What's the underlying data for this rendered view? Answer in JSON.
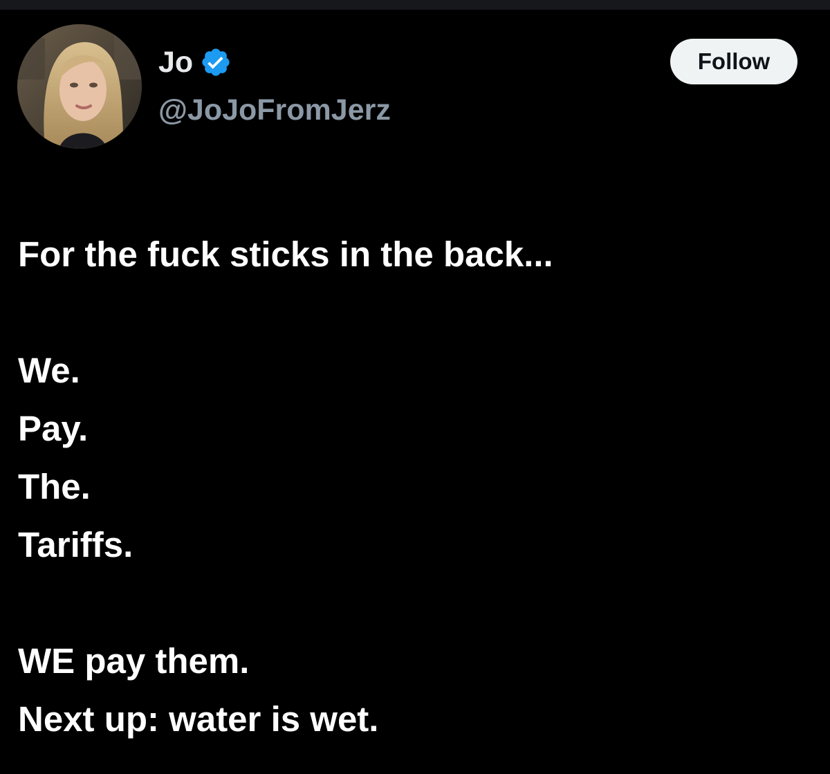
{
  "author": {
    "display_name": "Jo",
    "handle": "@JoJoFromJerz",
    "verified": true,
    "verified_icon": "verified-badge-icon",
    "avatar_icon": "profile-photo"
  },
  "follow_button": {
    "label": "Follow"
  },
  "post": {
    "lines": [
      "For the fuck sticks in the back...",
      "",
      "We.",
      "Pay.",
      "The.",
      "Tariffs.",
      "",
      "WE pay them.",
      "Next up: water is wet."
    ]
  },
  "colors": {
    "background": "#000000",
    "text": "#ffffff",
    "handle": "#8b98a5",
    "verified_badge": "#1d9bf0",
    "follow_button_bg": "#eff3f4",
    "follow_button_text": "#0f1419"
  }
}
